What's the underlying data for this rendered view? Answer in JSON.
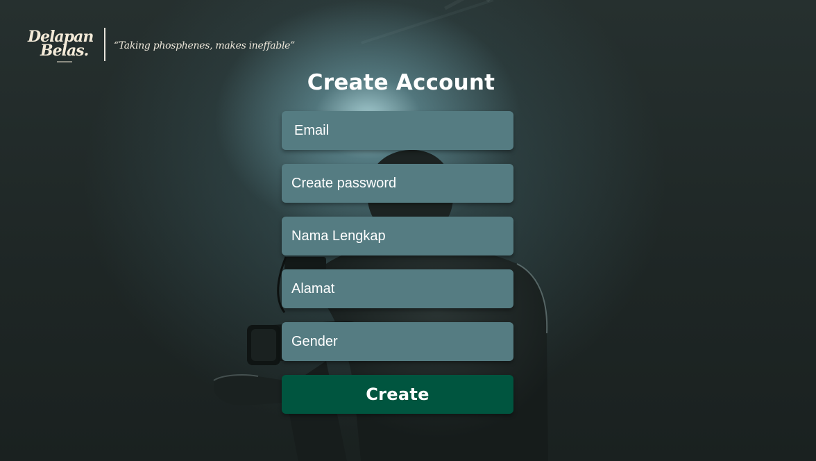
{
  "brand": {
    "logo_line1": "Delapan",
    "logo_line2": "Belas.",
    "tagline": "“Taking phosphenes, makes ineffable”"
  },
  "form": {
    "title": "Create Account",
    "fields": {
      "email": {
        "placeholder": "Email",
        "value": ""
      },
      "password": {
        "placeholder": "Create password",
        "value": ""
      },
      "full_name": {
        "placeholder": "Nama Lengkap",
        "value": ""
      },
      "address": {
        "placeholder": "Alamat",
        "value": ""
      },
      "gender": {
        "placeholder": "Gender",
        "value": ""
      }
    },
    "submit_label": "Create"
  },
  "colors": {
    "field_bg": "#557c82",
    "button_bg": "#00553f",
    "text": "#ffffff",
    "logo": "#f3ead8"
  }
}
